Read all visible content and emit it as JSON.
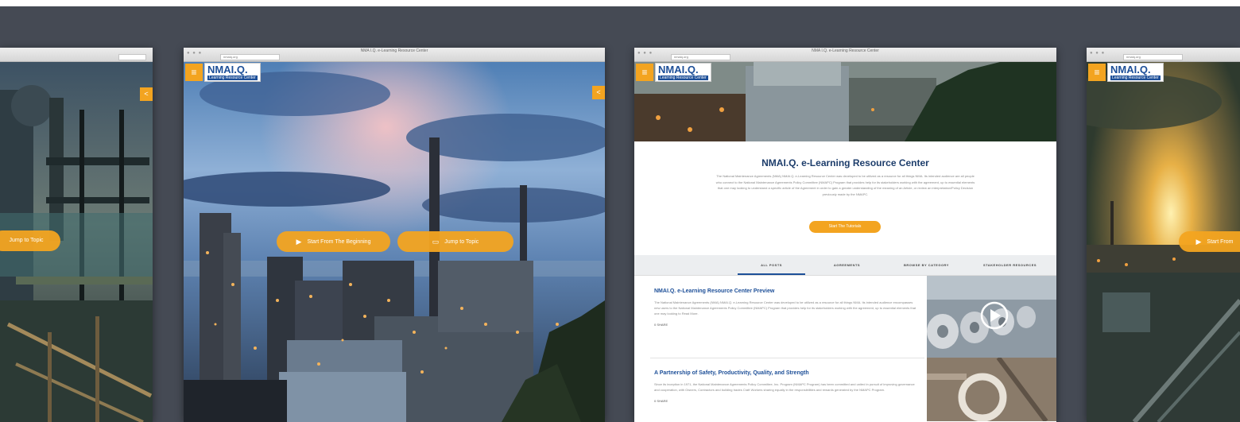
{
  "screens": {
    "frame1": {
      "cta_label": "Jump to Topic"
    },
    "frame2": {
      "url": "nmaiq.org",
      "tab_title": "NMA I.Q. e-Learning Resource Center",
      "logo_name": "NMAI.Q.",
      "logo_sub": "Learning Resource Center",
      "cta_start": "Start From The Beginning",
      "cta_jump": "Jump to Topic"
    },
    "frame3": {
      "url": "nmaiq.org",
      "tab_title": "NMA I.Q. e-Learning Resource Center",
      "logo_name": "NMAI.Q.",
      "logo_sub": "Learning Resource Center",
      "heading": "NMAI.Q. e-Learning Resource Center",
      "description": "The National Maintenance Agreements (NMA) NMAI.Q. e-Learning Resource Center was developed to be utilized as a resource for all things NMA. Its intended audience are all people who connect to the National Maintenance Agreements Policy Committee (NMAPC) Program that provides help for its stakeholders working with the agreement, up to essential elements that one may looking to understand a specific article of the Agreement in order to gain a greater understanding of the meaning of an Article, or review an interpretation/Policy Decision previously made by the NMAPC.",
      "cta": "Start The Tutorials",
      "tabs": [
        "ALL POSTS",
        "AGREEMENTS",
        "BROWSE BY CATEGORY",
        "STAKEHOLDER RESOURCES"
      ],
      "posts": [
        {
          "title": "NMAI.Q. e-Learning Resource Center Preview",
          "body": "The National Maintenance Agreements (NMA) NMAI.Q. e-Learning Resource Center was developed to be utilized as a resource for all things NMA. Its intended audience encompasses new users to the National Maintenance Agreements Policy Committee (NMAPC) Program that provides help for its stakeholders working with the agreement, up to essential elements that one may looking to Read More.",
          "more": "0 SHARE"
        },
        {
          "title": "A Partnership of Safety, Productivity, Quality, and Strength",
          "body": "Since its inception in 1971, the National Maintenance Agreements Policy Committee, Inc. Program (NMAPC Program) has been committed and united in pursuit of improving governance and cooperation, with Owners, Contractors and building trades Craft Workers sharing equally in the responsibilities and rewards generated by the NMAPC Program.",
          "more": "0 SHARE"
        }
      ]
    },
    "frame4": {
      "url": "nmaiq.org",
      "logo_name": "NMAI.Q.",
      "logo_sub": "Learning Resource Center",
      "cta": "Start From"
    }
  }
}
